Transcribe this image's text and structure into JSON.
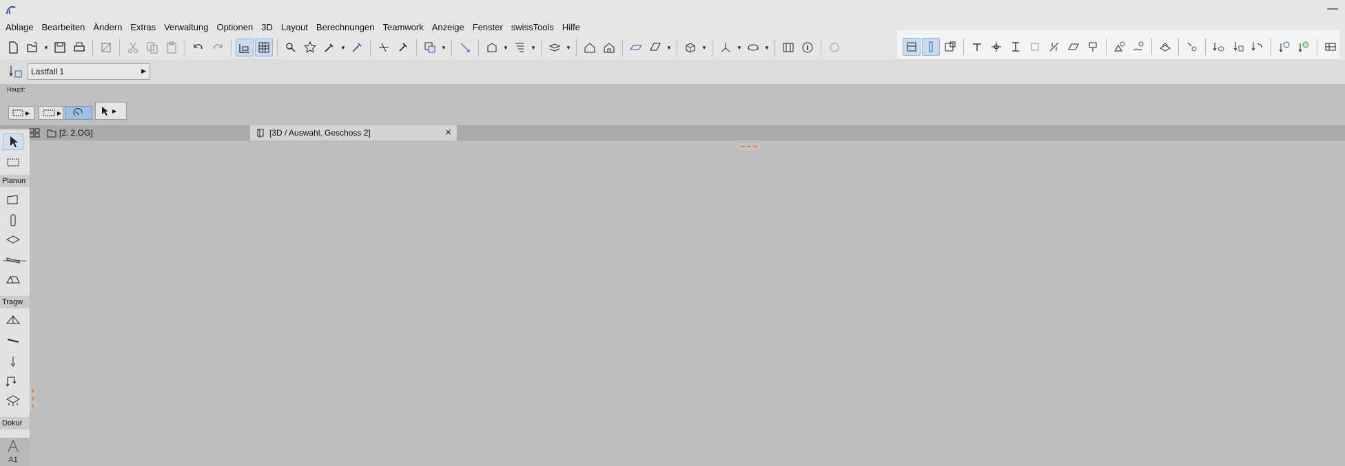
{
  "menubar": {
    "items": [
      "Ablage",
      "Bearbeiten",
      "Ändern",
      "Extras",
      "Verwaltung",
      "Optionen",
      "3D",
      "Layout",
      "Berechnungen",
      "Teamwork",
      "Anzeige",
      "Fenster",
      "swissTools",
      "Hilfe"
    ]
  },
  "toolbar2": {
    "load_case_value": "Lastfall 1"
  },
  "info_panel": {
    "label": "Haupt:"
  },
  "tabs": {
    "plan_label": "[2. 2.OG]",
    "view_3d_label": "[3D / Auswahl, Geschoss 2]",
    "close_glyph": "×"
  },
  "toolbox": {
    "category_design": "Planun",
    "category_structural": "Tragw",
    "category_document": "Dokur",
    "bottom_label": "A1"
  },
  "colors": {
    "chrome": "#e6e6e6",
    "canvas": "#bdbdbd",
    "active_highlight": "#c9dcef",
    "marker": "#d3854d"
  }
}
